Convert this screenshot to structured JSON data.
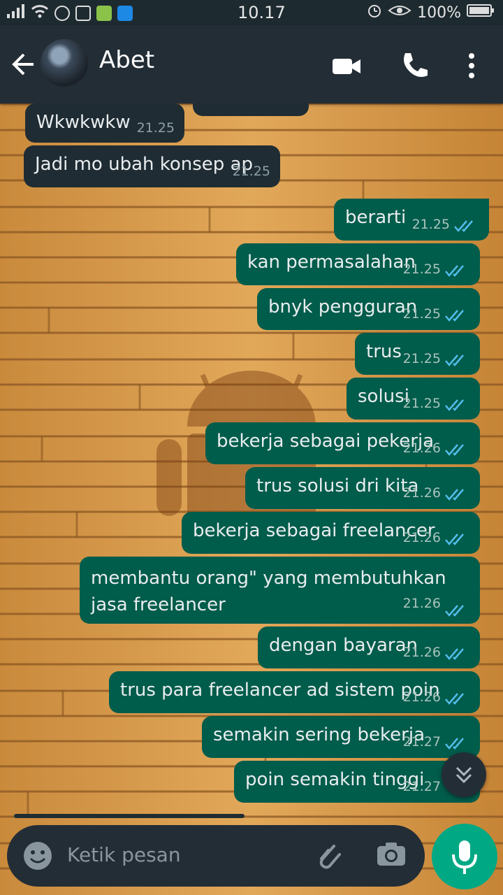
{
  "status_bar": {
    "time": "10.17",
    "battery": "100%"
  },
  "header": {
    "contact_name": "Abet",
    "icons": [
      "back-arrow-icon",
      "avatar",
      "video-call-icon",
      "phone-icon",
      "more-vert-icon"
    ]
  },
  "messages": {
    "m0": {
      "text": "Wkwkwkw",
      "time": "21.25",
      "dir": "in"
    },
    "m1": {
      "text": "Jadi mo ubah konsep ap",
      "time": "21.25",
      "dir": "in"
    },
    "m2": {
      "text": "berarti",
      "time": "21.25",
      "dir": "out"
    },
    "m3": {
      "text": "kan permasalahan",
      "time": "21.25",
      "dir": "out"
    },
    "m4": {
      "text": "bnyk pengguran",
      "time": "21.25",
      "dir": "out"
    },
    "m5": {
      "text": "trus",
      "time": "21.25",
      "dir": "out"
    },
    "m6": {
      "text": "solusi",
      "time": "21.25",
      "dir": "out"
    },
    "m7": {
      "text": "bekerja sebagai pekerja",
      "time": "21.26",
      "dir": "out"
    },
    "m8": {
      "text": "trus solusi dri kita",
      "time": "21.26",
      "dir": "out"
    },
    "m9": {
      "text": "bekerja sebagai freelancer",
      "time": "21.26",
      "dir": "out"
    },
    "m10": {
      "text": "membantu orang\" yang membutuhkan jasa freelancer",
      "time": "21.26",
      "dir": "out"
    },
    "m11": {
      "text": "dengan bayaran",
      "time": "21.26",
      "dir": "out"
    },
    "m12": {
      "text": "trus para freelancer ad sistem poin",
      "time": "21.26",
      "dir": "out"
    },
    "m13": {
      "text": "semakin sering bekerja",
      "time": "21.27",
      "dir": "out"
    },
    "m14": {
      "text": "poin semakin tinggi",
      "time": "21.27",
      "dir": "out"
    }
  },
  "composer": {
    "placeholder": "Ketik pesan"
  },
  "colors": {
    "header_bg": "#232d36",
    "outgoing_bubble": "#005c4b",
    "incoming_bubble": "#1f2c33",
    "read_ticks": "#53bdeb",
    "mic_button": "#00a884"
  }
}
